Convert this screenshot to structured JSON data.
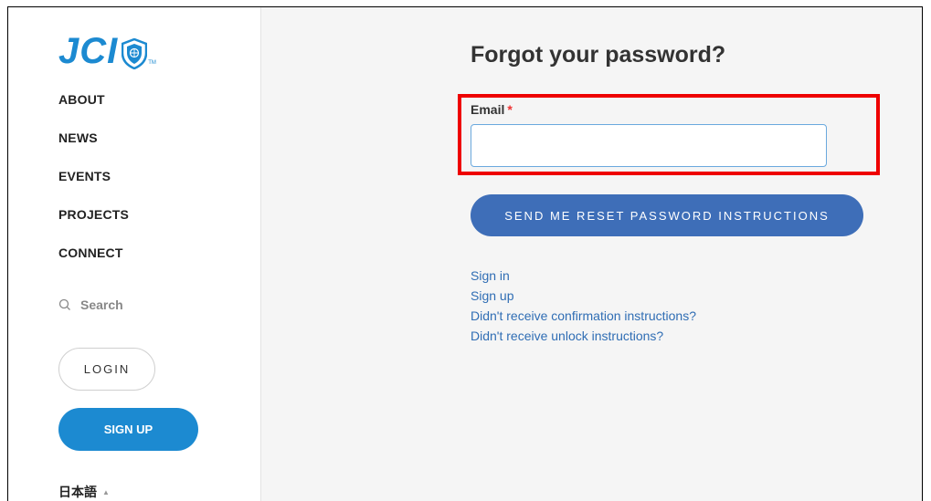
{
  "logo": {
    "text": "JCI",
    "tm": "TM"
  },
  "nav": [
    {
      "label": "ABOUT"
    },
    {
      "label": "NEWS"
    },
    {
      "label": "EVENTS"
    },
    {
      "label": "PROJECTS"
    },
    {
      "label": "CONNECT"
    }
  ],
  "search": {
    "label": "Search",
    "icon": "search-icon"
  },
  "auth": {
    "login_label": "LOGIN",
    "signup_label": "SIGN UP"
  },
  "language": {
    "label": "日本語",
    "caret": "▲"
  },
  "form": {
    "title": "Forgot your password?",
    "email_label": "Email",
    "required_mark": "*",
    "email_value": "",
    "submit_label": "SEND ME RESET PASSWORD INSTRUCTIONS"
  },
  "links": [
    {
      "label": "Sign in"
    },
    {
      "label": "Sign up"
    },
    {
      "label": "Didn't receive confirmation instructions?"
    },
    {
      "label": "Didn't receive unlock instructions?"
    }
  ],
  "colors": {
    "brand_blue": "#1c8ad1",
    "button_blue": "#3e6eb8",
    "link_blue": "#2f6db4",
    "highlight_red": "#ee0000"
  }
}
